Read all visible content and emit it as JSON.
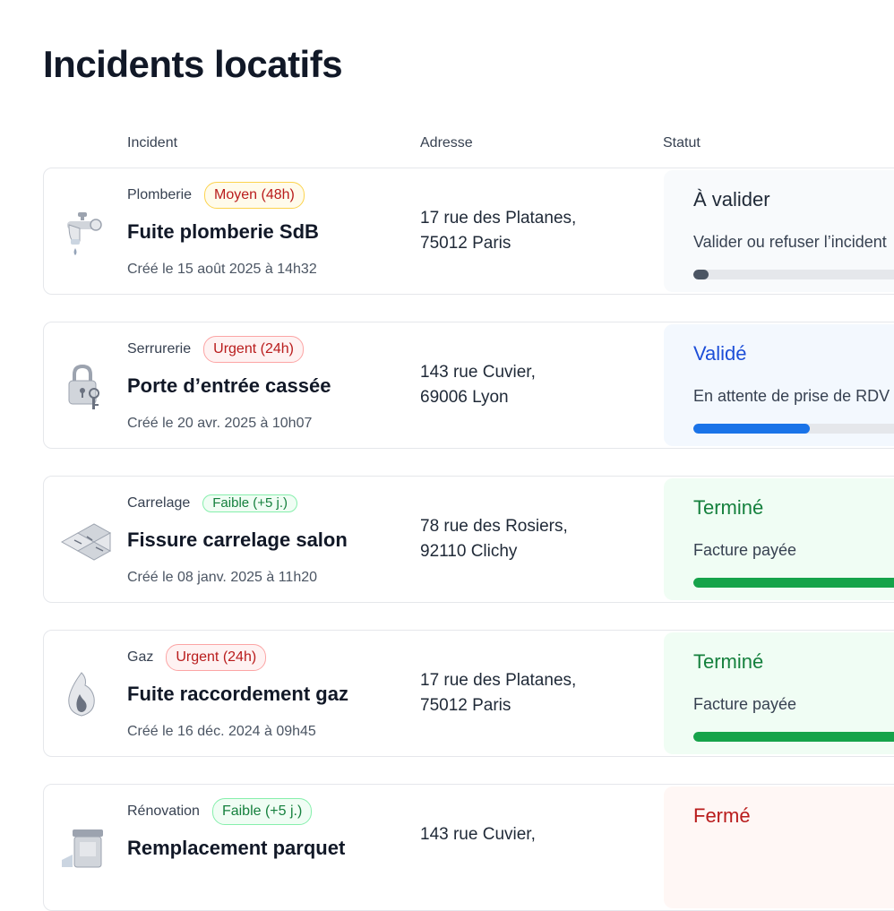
{
  "page": {
    "title": "Incidents locatifs"
  },
  "columns": {
    "incident": "Incident",
    "address": "Adresse",
    "status": "Statut"
  },
  "colors": {
    "pending_bg": "#f8fafc",
    "pending_text": "#1f2937",
    "pending_bar": "#4b5563",
    "validated_bg": "#f3f8fe",
    "validated_text": "#1d4ed8",
    "validated_bar": "#1a73e8",
    "done_bg": "#f0fdf4",
    "done_text": "#15803d",
    "done_bar": "#16a34a",
    "closed_bg": "#fff7f5",
    "closed_text": "#b91c1c"
  },
  "incidents": [
    {
      "category": "Plomberie",
      "priority": "Moyen (48h)",
      "title": "Fuite plomberie SdB",
      "created": "Créé le 15 août 2025 à 14h32",
      "address_line1": "17 rue des Platanes,",
      "address_line2": "75012 Paris",
      "status": "À valider",
      "status_sub": "Valider ou refuser l’incident",
      "progress": 0.06,
      "icon": "faucet-icon"
    },
    {
      "category": "Serrurerie",
      "priority": "Urgent (24h)",
      "title": "Porte d’entrée cassée",
      "created": "Créé le 20 avr. 2025 à 10h07",
      "address_line1": "143 rue Cuvier,",
      "address_line2": "69006 Lyon",
      "status": "Validé",
      "status_sub": "En attente de prise de RDV",
      "progress": 0.48,
      "icon": "padlock-icon"
    },
    {
      "category": "Carrelage",
      "priority": "Faible (+5 j.)",
      "title": "Fissure carrelage salon",
      "created": "Créé le 08 janv. 2025 à 11h20",
      "address_line1": "78 rue des Rosiers,",
      "address_line2": "92110 Clichy",
      "status": "Terminé",
      "status_sub": "Facture payée",
      "progress": 1.0,
      "icon": "tiles-icon"
    },
    {
      "category": "Gaz",
      "priority": "Urgent (24h)",
      "title": "Fuite raccordement gaz",
      "created": "Créé le 16 déc. 2024 à 09h45",
      "address_line1": "17 rue des Platanes,",
      "address_line2": "75012 Paris",
      "status": "Terminé",
      "status_sub": "Facture payée",
      "progress": 1.0,
      "icon": "flame-icon"
    },
    {
      "category": "Rénovation",
      "priority": "Faible (+5 j.)",
      "title": "Remplacement parquet",
      "created": "",
      "address_line1": "143 rue Cuvier,",
      "address_line2": "",
      "status": "Fermé",
      "status_sub": "",
      "progress": 0,
      "icon": "paint-bucket-icon"
    }
  ]
}
